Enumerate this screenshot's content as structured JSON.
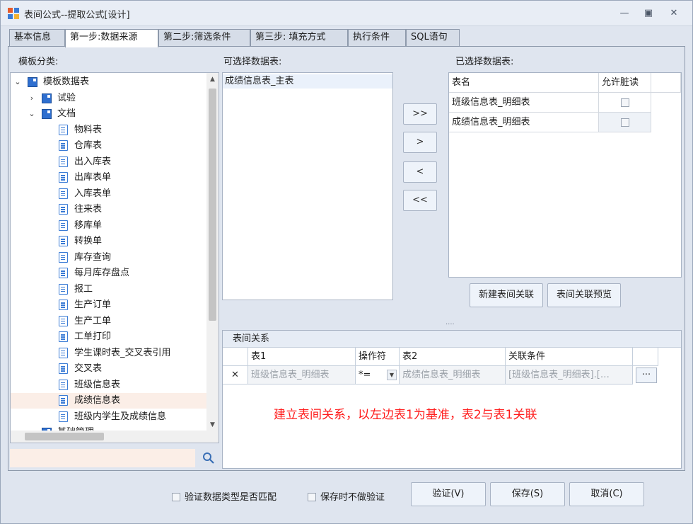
{
  "window": {
    "title": "表间公式--提取公式[设计]",
    "minimize_glyph": "—",
    "restore_glyph": "▣",
    "close_glyph": "✕"
  },
  "tabs": [
    {
      "label": "基本信息"
    },
    {
      "label": "第一步:数据来源"
    },
    {
      "label": "第二步:筛选条件"
    },
    {
      "label": "第三步: 填充方式"
    },
    {
      "label": "执行条件"
    },
    {
      "label": "SQL语句"
    }
  ],
  "active_tab": 1,
  "template_panel": {
    "label": "模板分类:",
    "tree": {
      "root": "模板数据表",
      "groups": [
        "试验",
        "文档"
      ],
      "docs": [
        "物料表",
        "仓库表",
        "出入库表",
        "出库表单",
        "入库表单",
        "往来表",
        "移库单",
        "转换单",
        "库存查询",
        "每月库存盘点",
        "报工",
        "生产订单",
        "生产工单",
        "工单打印",
        "学生课时表_交叉表引用",
        "交叉表",
        "班级信息表",
        "成绩信息表",
        "班级内学生及成绩信息"
      ],
      "selected": "成绩信息表",
      "partial_next": "基础管理"
    },
    "search": {
      "value": "",
      "placeholder": ""
    }
  },
  "available_tables": {
    "label": "可选择数据表:",
    "items": [
      "成绩信息表_主表"
    ]
  },
  "move_buttons": [
    ">>",
    ">",
    "<",
    "<<"
  ],
  "selected_tables": {
    "label": "已选择数据表:",
    "headers": [
      "表名",
      "允许脏读"
    ],
    "rows": [
      {
        "name": "班级信息表_明细表",
        "dirty_read": false
      },
      {
        "name": "成绩信息表_明细表",
        "dirty_read": false
      }
    ]
  },
  "relation_buttons": {
    "new": "新建表间关联",
    "preview": "表间关联预览"
  },
  "splitter_grip": "....",
  "relations": {
    "title": "表间关系",
    "headers": [
      "表1",
      "操作符",
      "表2",
      "关联条件"
    ],
    "row": {
      "delete": "✕",
      "table1": "班级信息表_明细表",
      "operator": "*=",
      "table2": "成绩信息表_明细表",
      "condition": "[班级信息表_明细表].[…",
      "more": "···"
    },
    "annotation": "建立表间关系，以左边表1为基准，表2与表1关联"
  },
  "footer": {
    "check_type": "验证数据类型是否匹配",
    "no_validate": "保存时不做验证",
    "verify": "验证(V)",
    "save": "保存(S)",
    "cancel": "取消(C)"
  },
  "colors": {
    "accent": "#2f6fcf",
    "annotation": "#ff1a1a",
    "selection": "#fbeee7"
  }
}
